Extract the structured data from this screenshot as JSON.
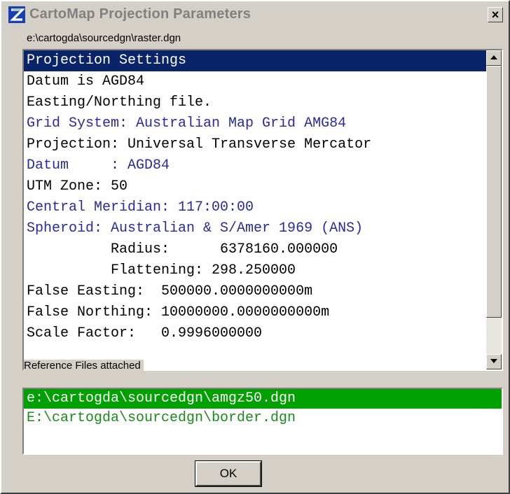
{
  "window": {
    "title": "CartoMap Projection Parameters",
    "close_label": "×",
    "file_path": "e:\\cartogda\\sourcedgn\\raster.dgn"
  },
  "settings": {
    "lines": [
      {
        "text": "Projection Settings",
        "color": "black",
        "selected": true
      },
      {
        "text": "Datum is AGD84",
        "color": "black"
      },
      {
        "text": "Easting/Northing file.",
        "color": "black"
      },
      {
        "text": "Grid System: Australian Map Grid AMG84",
        "color": "blue"
      },
      {
        "text": "Projection: Universal Transverse Mercator",
        "color": "black"
      },
      {
        "text": "Datum     : AGD84",
        "color": "blue"
      },
      {
        "text": "UTM Zone: 50",
        "color": "black"
      },
      {
        "text": "Central Meridian: 117:00:00",
        "color": "blue"
      },
      {
        "text": "Spheroid: Australian & S/Amer 1969 (ANS)",
        "color": "blue"
      },
      {
        "text": "          Radius:      6378160.000000",
        "color": "black"
      },
      {
        "text": "          Flattening: 298.250000",
        "color": "black"
      },
      {
        "text": "False Easting:  500000.0000000000m",
        "color": "black"
      },
      {
        "text": "False Northing: 10000000.0000000000m",
        "color": "black"
      },
      {
        "text": "Scale Factor:   0.9996000000",
        "color": "black"
      }
    ]
  },
  "references": {
    "label": "Reference Files attached",
    "files": [
      {
        "text": "e:\\cartogda\\sourcedgn\\amgz50.dgn",
        "selected": true
      },
      {
        "text": "E:\\cartogda\\sourcedgn\\border.dgn",
        "selected": false
      }
    ]
  },
  "buttons": {
    "ok_label": "OK"
  },
  "colors": {
    "selection_blue": "#0a246a",
    "blue_text": "#2a2a9c",
    "selection_green": "#00a000",
    "green_text": "#1a8a1a"
  },
  "icons": {
    "app": "cartomap-logo-icon",
    "close": "close-icon",
    "scroll_up": "arrow-up-icon",
    "scroll_down": "arrow-down-icon"
  }
}
